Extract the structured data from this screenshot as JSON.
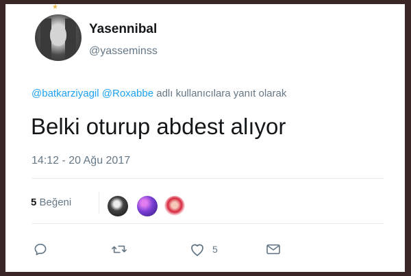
{
  "user": {
    "display_name": "Yasennibal",
    "handle": "@yasseminss"
  },
  "reply": {
    "mentions": [
      "@batkarziyagil",
      "@Roxabbe"
    ],
    "suffix": "adlı kullanıcılara yanıt olarak"
  },
  "tweet": {
    "text": "Belki oturup abdest alıyor",
    "timestamp": "14:12 - 20 Ağu 2017"
  },
  "likes": {
    "count": "5",
    "label": "Beğeni"
  },
  "actions": {
    "like_count": "5"
  },
  "icons": {
    "reply": "reply-icon",
    "retweet": "retweet-icon",
    "like": "heart-icon",
    "message": "envelope-icon"
  },
  "colors": {
    "accent": "#1da1f2",
    "text": "#14171a",
    "muted": "#657786"
  }
}
